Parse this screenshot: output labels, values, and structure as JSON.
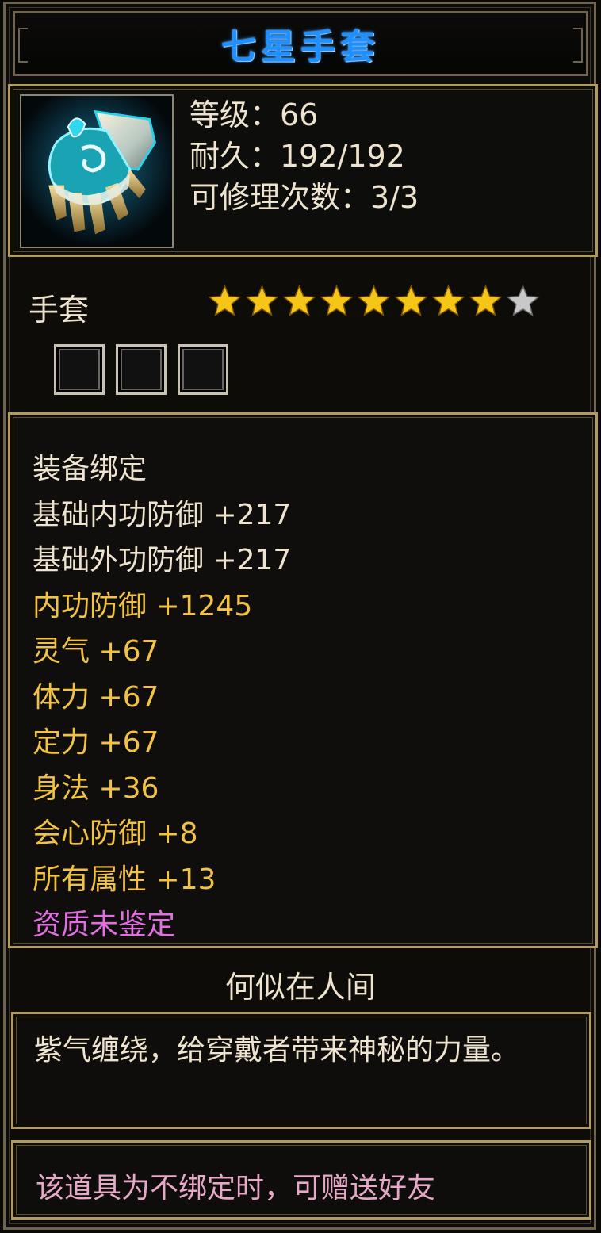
{
  "item": {
    "name": "七星手套",
    "level_label": "等级：66",
    "durability_label": "耐久：192/192",
    "repair_label": "可修理次数：3/3",
    "type": "手套",
    "stars_total": 9,
    "stars_filled": 8,
    "sockets_count": 3
  },
  "attributes": [
    {
      "text": "装备绑定",
      "color": "white"
    },
    {
      "text": "基础内功防御  +217",
      "color": "white"
    },
    {
      "text": "基础外功防御  +217",
      "color": "white"
    },
    {
      "text": "内功防御  +1245",
      "color": "gold"
    },
    {
      "text": "灵气  +67",
      "color": "gold"
    },
    {
      "text": "体力  +67",
      "color": "gold"
    },
    {
      "text": "定力  +67",
      "color": "gold"
    },
    {
      "text": "身法  +36",
      "color": "gold"
    },
    {
      "text": "会心防御  +8",
      "color": "gold"
    },
    {
      "text": "所有属性  +13",
      "color": "gold"
    },
    {
      "text": "资质未鉴定",
      "color": "purple"
    }
  ],
  "set_name": "何似在人间",
  "description": "紫气缠绕，给穿戴者带来神秘的力量。",
  "gift_note": "该道具为不绑定时，可赠送好友",
  "colors": {
    "title": "#1e90ff",
    "gold_text": "#f2c245",
    "white_text": "#eee3cf",
    "purple_text": "#e26fe0",
    "border_gold": "#b39a5e",
    "star_filled": "#f5c518",
    "star_empty": "#c8c8c8"
  },
  "icons": {
    "item_icon": "gauntlet-icon",
    "star": "star-icon",
    "socket": "gem-socket-icon"
  }
}
